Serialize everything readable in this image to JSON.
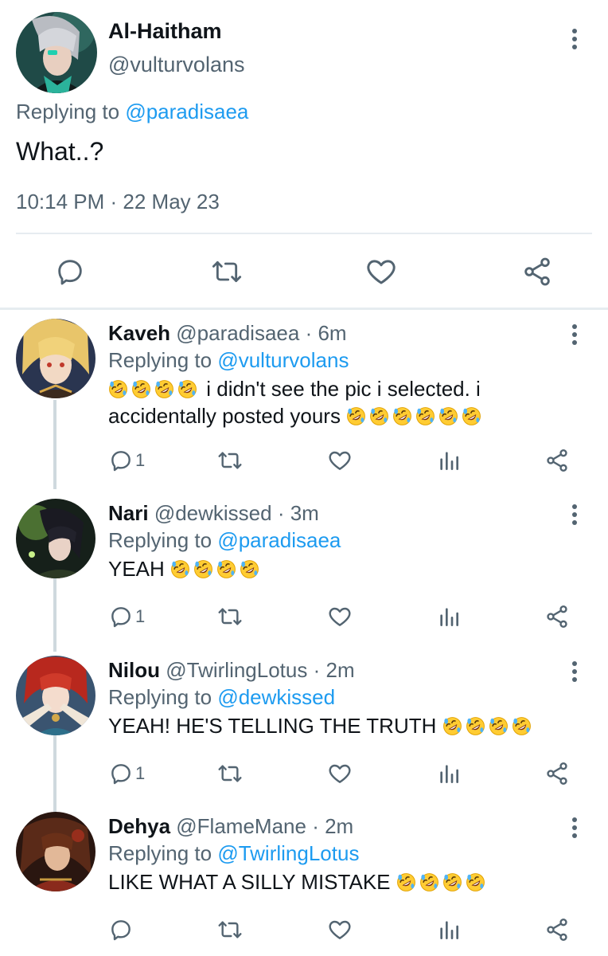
{
  "main_tweet": {
    "author_name": "Al-Haitham",
    "author_handle": "@vulturvolans",
    "replying_prefix": "Replying to",
    "replying_to": "@paradisaea",
    "text": "What..?",
    "timestamp": "10:14 PM · 22 May 23",
    "actions": [
      "reply-icon",
      "retweet-icon",
      "like-icon",
      "share-icon"
    ]
  },
  "replies": [
    {
      "name": "Kaveh",
      "handle": "@paradisaea",
      "time": "· 6m",
      "replying_prefix": "Replying to",
      "replying_to": "@vulturvolans",
      "text_before": "i didn't see the pic i selected. i accidentally posted yours",
      "leading_emoji_count": 4,
      "trailing_emoji_count": 6,
      "emoji_name": "rolling-on-the-floor-laughing-emoji",
      "reply_count": "1"
    },
    {
      "name": "Nari",
      "handle": "@dewkissed",
      "time": "· 3m",
      "replying_prefix": "Replying to",
      "replying_to": "@paradisaea",
      "text": "YEAH",
      "trailing_emoji_count": 4,
      "emoji_name": "rolling-on-the-floor-laughing-emoji",
      "reply_count": "1"
    },
    {
      "name": "Nilou",
      "handle": "@TwirlingLotus",
      "time": "· 2m",
      "replying_prefix": "Replying to",
      "replying_to": "@dewkissed",
      "text": "YEAH! HE'S TELLING THE TRUTH",
      "trailing_emoji_count": 4,
      "emoji_name": "rolling-on-the-floor-laughing-emoji",
      "reply_count": "1"
    },
    {
      "name": "Dehya",
      "handle": "@FlameMane",
      "time": "· 2m",
      "replying_prefix": "Replying to",
      "replying_to": "@TwirlingLotus",
      "text": "LIKE WHAT A SILLY MISTAKE",
      "trailing_emoji_count": 4,
      "emoji_name": "rolling-on-the-floor-laughing-emoji",
      "reply_count": ""
    }
  ],
  "colors": {
    "text_primary": "#0f1419",
    "text_secondary": "#536471",
    "link": "#1d9bf0",
    "divider": "#e6ecf0",
    "thread_line": "#cfd9de"
  }
}
